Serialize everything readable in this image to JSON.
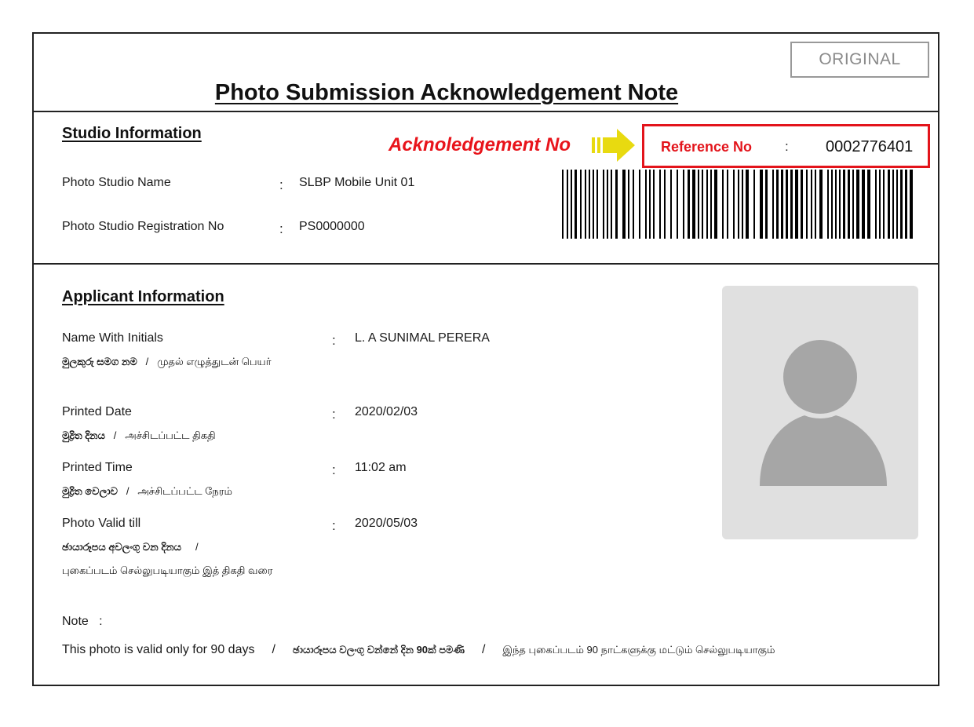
{
  "header": {
    "stamp": "ORIGINAL",
    "title": "Photo Submission Acknowledgement Note"
  },
  "studio": {
    "section_title": "Studio Information",
    "ack_label": "Acknoledgement No",
    "reference_label": "Reference No",
    "reference_value": "0002776401",
    "fields": [
      {
        "label": "Photo Studio Name",
        "value": "SLBP Mobile Unit 01"
      },
      {
        "label": "Photo Studio Registration No",
        "value": "PS0000000"
      }
    ]
  },
  "applicant": {
    "section_title": "Applicant Information",
    "fields": [
      {
        "label": "Name With Initials",
        "sinhala": "මුලකුරු සමග නම",
        "tamil": "முதல் எழுத்துடன் பெயர்",
        "value": "L. A SUNIMAL PERERA"
      },
      {
        "label": "Printed Date",
        "sinhala": "මුද්‍රිත දිනය",
        "tamil": "அச்சிடப்பட்ட திகதி",
        "value": "2020/02/03"
      },
      {
        "label": "Printed Time",
        "sinhala": "මුද්‍රිත වෙලාව",
        "tamil": "அச்சிடப்பட்ட நேரம்",
        "value": "11:02 am"
      },
      {
        "label": "Photo Valid till",
        "sinhala": "ඡායාරූපය අවලංගු වන දිනය",
        "tamil": "புகைப்படம் செல்லுபடியாகும் இத் திகதி வரை",
        "value": "2020/05/03"
      }
    ],
    "photo_icon": "person-silhouette-icon"
  },
  "note": {
    "label": "Note",
    "english": "This photo is valid only for 90 days",
    "sinhala": "ඡායාරූපය වලංගු වන්නේ දින 90ක් පමණි",
    "tamil": "இந்த புகைப்படம் 90 நாட்களுக்கு மட்டும் செல்லுபடியாகும்"
  },
  "colors": {
    "accent_red": "#e3141b",
    "arrow_yellow": "#e8da10",
    "photo_bg": "#e0e0e0",
    "silhouette": "#a6a6a6"
  }
}
